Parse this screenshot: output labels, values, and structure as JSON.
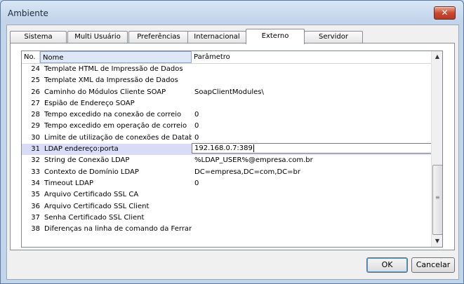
{
  "window": {
    "title": "Ambiente",
    "close_label": "✕"
  },
  "tabs": [
    {
      "label": "Sistema",
      "active": false
    },
    {
      "label": "Multi Usuário",
      "active": false
    },
    {
      "label": "Preferências",
      "active": false
    },
    {
      "label": "Internacional",
      "active": false
    },
    {
      "label": "Externo",
      "active": true
    },
    {
      "label": "Servidor",
      "active": false
    }
  ],
  "grid": {
    "columns": {
      "no": "No.",
      "name": "Nome",
      "param": "Parâmetro"
    },
    "rows": [
      {
        "no": "24",
        "name": "Template HTML de Impressão de Dados",
        "param": ""
      },
      {
        "no": "25",
        "name": "Template XML da Impressão de Dados",
        "param": ""
      },
      {
        "no": "26",
        "name": "Caminho do Módulos Cliente SOAP",
        "param": "SoapClientModules\\"
      },
      {
        "no": "27",
        "name": "Espião de Endereço SOAP",
        "param": ""
      },
      {
        "no": "28",
        "name": "Tempo excedido na conexão de correio",
        "param": "0"
      },
      {
        "no": "29",
        "name": "Tempo excedido em operação de correio",
        "param": "0"
      },
      {
        "no": "30",
        "name": "Limite de utilização de conexões de Database",
        "param": "0"
      },
      {
        "no": "31",
        "name": "LDAP endereço:porta",
        "param": "192.168.0.7:389"
      },
      {
        "no": "32",
        "name": "String de Conexão LDAP",
        "param": "%LDAP_USER%@empresa.com.br"
      },
      {
        "no": "33",
        "name": "Contexto de Domínio LDAP",
        "param": "DC=empresa,DC=com,DC=br"
      },
      {
        "no": "34",
        "name": "Timeout LDAP",
        "param": "0"
      },
      {
        "no": "35",
        "name": "Arquivo Certificado SSL CA",
        "param": ""
      },
      {
        "no": "36",
        "name": "Arquivo Certificado SSL Client",
        "param": ""
      },
      {
        "no": "37",
        "name": "Senha Certificado SSL Client",
        "param": ""
      },
      {
        "no": "38",
        "name": "Diferenças na linha de comando da Ferramen",
        "param": ""
      }
    ],
    "selected_row": "31"
  },
  "buttons": {
    "ok": "OK",
    "cancel": "Cancelar"
  },
  "icons": {
    "scroll_up": "▲",
    "scroll_down": "▼",
    "grip": "≡"
  },
  "colors": {
    "selected_row": "#d9dcf7",
    "close_button": "#c94a30"
  }
}
